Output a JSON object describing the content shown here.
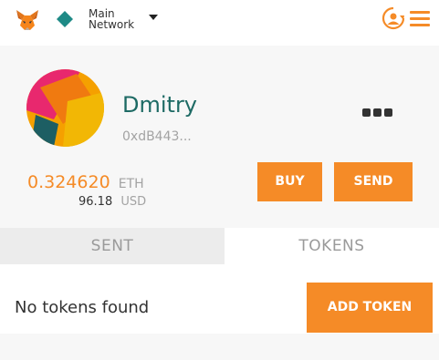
{
  "topbar": {
    "network": {
      "line1": "Main",
      "line2": "Network"
    },
    "icons": {
      "logo": "metamask-fox-icon",
      "network": "network-diamond-icon",
      "caret": "chevron-down-icon",
      "account": "account-switch-icon",
      "menu": "hamburger-menu-icon"
    }
  },
  "account": {
    "name": "Dmitry",
    "address": "0xdB443...",
    "eth_balance": "0.324620",
    "eth_unit": "ETH",
    "usd_balance": "96.18",
    "usd_unit": "USD",
    "more_icon": "more-options-icon"
  },
  "actions": {
    "buy_label": "BUY",
    "send_label": "SEND"
  },
  "tabs": [
    {
      "label": "SENT",
      "selected": false
    },
    {
      "label": "TOKENS",
      "selected": true
    }
  ],
  "tokens": {
    "empty_message": "No tokens found",
    "add_label": "ADD TOKEN"
  },
  "colors": {
    "accent": "#f58b27",
    "account_name": "#1d6a64",
    "network_diamond": "#1e8a86"
  }
}
